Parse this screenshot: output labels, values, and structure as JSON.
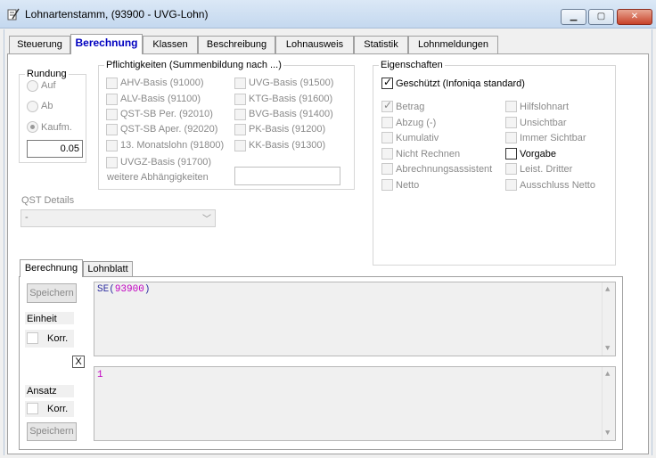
{
  "window": {
    "title": "Lohnartenstamm, (93900 - UVG-Lohn)",
    "minimize": "▁",
    "maximize": "▢",
    "close": "✕"
  },
  "tabs": [
    {
      "label": "Steuerung"
    },
    {
      "label": "Berechnung",
      "active": true
    },
    {
      "label": "Klassen"
    },
    {
      "label": "Beschreibung"
    },
    {
      "label": "Lohnausweis"
    },
    {
      "label": "Statistik"
    },
    {
      "label": "Lohnmeldungen"
    }
  ],
  "rundung": {
    "legend": "Rundung",
    "options": [
      {
        "label": "Auf",
        "selected": false
      },
      {
        "label": "Ab",
        "selected": false
      },
      {
        "label": "Kaufm.",
        "selected": true
      }
    ],
    "value": "0.05"
  },
  "pflicht": {
    "legend": "Pflichtigkeiten (Summenbildung nach  ...)",
    "left": [
      "AHV-Basis (91000)",
      "ALV-Basis (91100)",
      "QST-SB Per. (92010)",
      "QST-SB Aper. (92020)",
      "13. Monatslohn (91800)",
      "UVGZ-Basis (91700)"
    ],
    "right": [
      "UVG-Basis (91500)",
      "KTG-Basis (91600)",
      "BVG-Basis (91400)",
      "PK-Basis (91200)",
      "KK-Basis (91300)"
    ],
    "weitere": "weitere Abhängigkeiten"
  },
  "qst": {
    "label": "QST Details",
    "value": "-"
  },
  "eigenschaften": {
    "legend": "Eigenschaften",
    "geschuetzt": {
      "label": "Geschützt (Infoniqa standard)",
      "checked": true
    },
    "left": [
      {
        "label": "Betrag",
        "checked": true
      },
      {
        "label": "Abzug (-)",
        "checked": false
      },
      {
        "label": "Kumulativ",
        "checked": false
      },
      {
        "label": "Nicht Rechnen",
        "checked": false
      },
      {
        "label": "Abrechnungsassistent",
        "checked": false
      },
      {
        "label": "Netto",
        "checked": false
      }
    ],
    "right": [
      {
        "label": "Hilfslohnart",
        "checked": false
      },
      {
        "label": "Unsichtbar",
        "checked": false
      },
      {
        "label": "Immer Sichtbar",
        "checked": false
      },
      {
        "label": "Vorgabe",
        "checked": false,
        "enabled": true
      },
      {
        "label": "Leist. Dritter",
        "checked": false
      },
      {
        "label": "Ausschluss Netto",
        "checked": false
      }
    ]
  },
  "subtabs": [
    {
      "label": "Berechnung",
      "active": true
    },
    {
      "label": "Lohnblatt"
    }
  ],
  "berechnung": {
    "speichern1": "Speichern",
    "einheit": "Einheit",
    "korr1": "Korr.",
    "x_button": "X",
    "ansatz": "Ansatz",
    "korr2": "Korr.",
    "speichern2": "Speichern",
    "formula_fn": "SE(",
    "formula_arg": "93900",
    "formula_close": ")",
    "formula2": "1"
  },
  "colors": {
    "formula_fn": "#3030a0",
    "formula_arg": "#c000c0",
    "active_tab": "#0000c0"
  }
}
